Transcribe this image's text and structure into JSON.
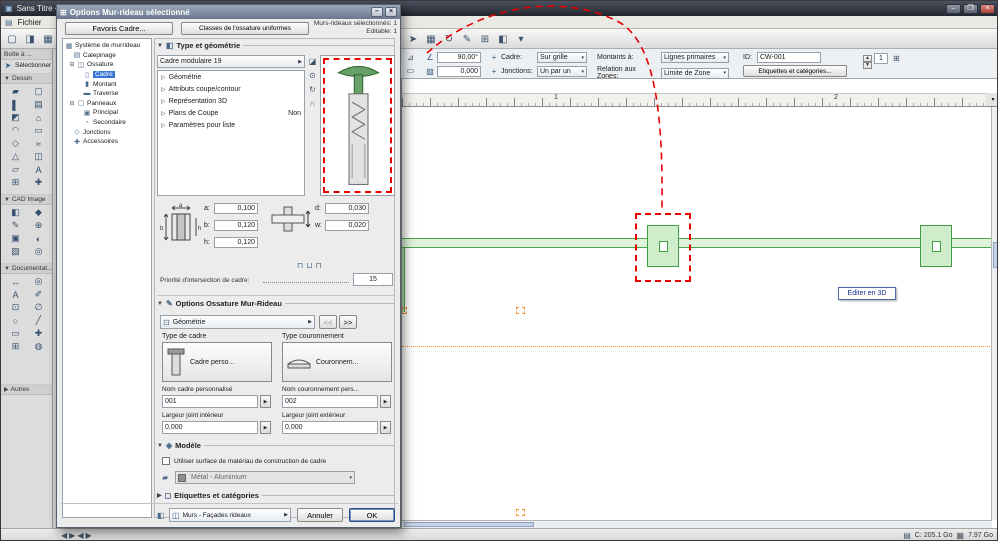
{
  "app": {
    "title": "Sans Titre -",
    "menu_file": "Fichier",
    "menu_icon": "▤",
    "quick_icons": [
      "▢",
      "◨",
      "▦",
      "✎"
    ],
    "window_min": "–",
    "window_max": "❐",
    "window_close": "×"
  },
  "ui": {
    "tri_open": "▼",
    "tri_closed": "▶",
    "tri_item": "▷",
    "car_down": "▾",
    "arrow_btn": "▶",
    "ruler_unit": "▾"
  },
  "toolbar": {
    "icons": [
      "➤",
      "▦",
      "↻",
      "✎",
      "⊞",
      "◧",
      "▾"
    ],
    "geo_icon1": "⊿",
    "geo_icon2": "▭",
    "angle_icon": "∠",
    "angle_value": "90,00°",
    "hatch_icon": "▨",
    "offset_value": "0,000",
    "cadre_icon": "+",
    "cadre_label": "Cadre:",
    "cadre_value": "Sur grille",
    "jonctions_label": "Jonctions:",
    "jonctions_value": "Un par un",
    "montants_label": "Montants à:",
    "montants_value": "Lignes primaires",
    "relation_label": "Relation aux Zones:",
    "relation_value": "Limite de Zone",
    "id_label": "ID:",
    "id_value": "CW-001",
    "etiquettes_button": "Etiquettes et catégories...",
    "spin_up": "▲",
    "spin_down": "▼",
    "count_value": "1",
    "grid_icon": "⊞"
  },
  "palette": {
    "header": "Boîte à ...",
    "select_label": "Sélectionner",
    "select_icon": "➤",
    "dessin_label": "Dessin",
    "dessin_icons": [
      "▰",
      "▢",
      "▌",
      "▤",
      "◩",
      "⌂",
      "◠",
      "▭",
      "◇",
      "≈",
      "△",
      "◫",
      "▱",
      "A",
      "⊞",
      "✚"
    ],
    "cad_label": "CAD Image",
    "cad_icons": [
      "◧",
      "◆",
      "✎",
      "⊕",
      "▣",
      "◐",
      "▧",
      "◎"
    ],
    "doc_label": "Documentat...",
    "doc_icons": [
      "↔",
      "◎",
      "A",
      "✐",
      "⊡",
      "∅",
      "○",
      "╱",
      "▭",
      "✚",
      "⊞",
      "◍"
    ],
    "autres_label": "Autres"
  },
  "dialog": {
    "title": "Options Mur-rideau sélectionné",
    "title_icon": "⊞",
    "min": "–",
    "close": "×",
    "favoris": "Favoris Cadre...",
    "classes": "Classes de l'ossature uniformes",
    "sel_line1": "Murs-rideaux sélectionnés: 1",
    "sel_line2": "Editable: 1",
    "tree": [
      {
        "icon": "▦",
        "label": "Système de murrideau"
      },
      {
        "icon": "▤",
        "label": "Calepinage"
      },
      {
        "icon": "◫",
        "label": "Ossature",
        "exp": "⊟"
      },
      {
        "icon": "▯",
        "label": "Cadre"
      },
      {
        "icon": "▮",
        "label": "Montant"
      },
      {
        "icon": "▬",
        "label": "Traverse"
      },
      {
        "icon": "▢",
        "label": "Panneaux",
        "exp": "⊟"
      },
      {
        "icon": "▣",
        "label": "Principal"
      },
      {
        "icon": "▫",
        "label": "Secondaire"
      },
      {
        "icon": "◇",
        "label": "Jonctions"
      },
      {
        "icon": "✚",
        "label": "Accessoires"
      }
    ],
    "sec_type": "Type et géométrie",
    "sec_type_icon": "◧",
    "profile_dd": "Cadre modulaire 19",
    "list": [
      "Géométrie",
      "Attributs coupe/contour",
      "Représentation 3D",
      "Plans de Coupe",
      "Paramètres pour liste"
    ],
    "plans_value": "Non",
    "preview_icons": [
      "◪",
      "⊙",
      "↻",
      "∩"
    ],
    "dims": {
      "a_lbl": "a:",
      "a": "0,100",
      "b_lbl": "b:",
      "b": "0,120",
      "h_lbl": "h:",
      "h": "0,120",
      "d_lbl": "d:",
      "d": "0,030",
      "w_lbl": "w:",
      "w": "0,020",
      "a_letter": "a",
      "b_letter": "b",
      "h_letter": "h"
    },
    "priority_icons": [
      "⊓",
      "⊔",
      "⊓"
    ],
    "priority_label": "Priorité d'intersection de cadre:",
    "priority_value": "15",
    "sec_ossature": "Options Ossature Mur-Rideau",
    "sec_oss_icon": "✎",
    "geo_icon": "⊡",
    "geo_dd": "Géométrie",
    "nav_prev": "<<",
    "nav_next": ">>",
    "type_cadre_lbl": "Type de cadre",
    "type_cadre_btn": "Cadre perso...",
    "type_cour_lbl": "Type couronnement",
    "type_cour_btn": "Couronnem...",
    "nom_cadre_lbl": "Nom cadre personnalisé",
    "nom_cadre_val": "001",
    "nom_cour_lbl": "Nom couronnement pers...",
    "nom_cour_val": "002",
    "larg_int_lbl": "Largeur joint intérieur",
    "larg_int_val": "0,000",
    "larg_ext_lbl": "Largeur joint extérieur",
    "larg_ext_val": "0,000",
    "sec_modele": "Modèle",
    "sec_mod_icon": "◈",
    "chk_label": "Utiliser surface de matériau de construction de cadre",
    "mat_icon": "▰",
    "material": "Métal - Aluminium",
    "sec_etiq": "Etiquettes et catégories",
    "sec_etq_icon": "◻",
    "layer_outicon": "◧",
    "layer_icon": "◫",
    "layer": "Murs - Façades rideaux",
    "cancel": "Annuler",
    "ok": "OK"
  },
  "canvas": {
    "ruler_1": "1",
    "ruler_2": "2",
    "edit3d": "Editer en 3D"
  },
  "statusbar": {
    "nav_icons": [
      "◀",
      "▶",
      "◀",
      "▶"
    ],
    "disk_icon": "▤",
    "disk": "C: 205.1 Go",
    "memory_icon": "▦",
    "memory": "7.97 Go"
  }
}
